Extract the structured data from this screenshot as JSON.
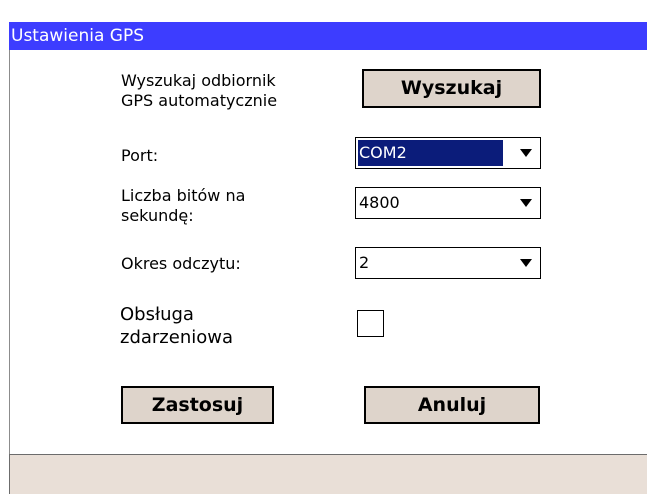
{
  "window": {
    "title": "Ustawienia GPS"
  },
  "search": {
    "label_line1": "Wyszukaj odbiornik",
    "label_line2": "GPS automatycznie",
    "button_label": "Wyszukaj"
  },
  "port": {
    "label": "Port:",
    "value": "COM2"
  },
  "baud": {
    "label_line1": "Liczba bitów na",
    "label_line2": "sekundę:",
    "value": "4800"
  },
  "period": {
    "label": "Okres odczytu:",
    "value": "2"
  },
  "events": {
    "label_line1": "Obsługa",
    "label_line2": "zdarzeniowa",
    "checked": false
  },
  "buttons": {
    "apply": "Zastosuj",
    "cancel": "Anuluj"
  }
}
